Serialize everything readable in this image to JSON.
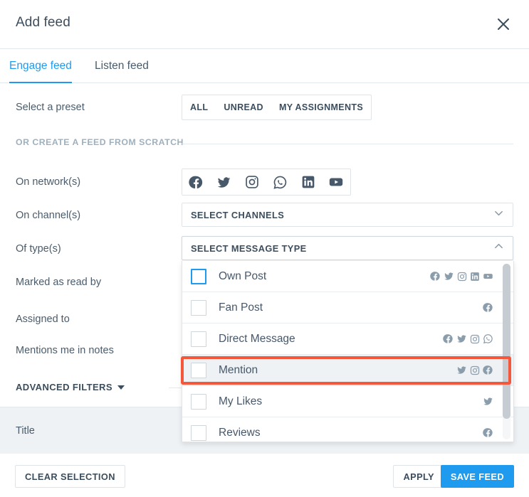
{
  "header": {
    "title": "Add feed",
    "close_icon": "close-icon"
  },
  "tabs": [
    {
      "label": "Engage feed",
      "active": true
    },
    {
      "label": "Listen feed",
      "active": false
    }
  ],
  "form": {
    "preset_label": "Select a preset",
    "presets": [
      "ALL",
      "UNREAD",
      "MY ASSIGNMENTS"
    ],
    "scratch_label": "OR CREATE A FEED FROM SCRATCH",
    "network_label": "On network(s)",
    "networks": [
      "facebook-icon",
      "twitter-icon",
      "instagram-icon",
      "whatsapp-icon",
      "linkedin-icon",
      "youtube-icon"
    ],
    "channel_label": "On channel(s)",
    "channel_select_value": "SELECT CHANNELS",
    "type_label": "Of type(s)",
    "type_select_value": "SELECT MESSAGE TYPE",
    "marked_read_label": "Marked as read by",
    "assigned_to_label": "Assigned to",
    "mentions_me_label": "Mentions me in notes",
    "advanced_filters_label": "ADVANCED FILTERS",
    "title_label": "Title"
  },
  "message_type_dropdown": {
    "expanded": true,
    "options": [
      {
        "label": "Own Post",
        "checked": false,
        "focused": true,
        "hover": false,
        "networks": [
          "facebook-icon",
          "twitter-icon",
          "instagram-icon",
          "linkedin-icon",
          "youtube-icon"
        ]
      },
      {
        "label": "Fan Post",
        "checked": false,
        "focused": false,
        "hover": false,
        "networks": [
          "facebook-icon"
        ]
      },
      {
        "label": "Direct Message",
        "checked": false,
        "focused": false,
        "hover": false,
        "networks": [
          "facebook-icon",
          "twitter-icon",
          "instagram-icon",
          "whatsapp-icon"
        ]
      },
      {
        "label": "Mention",
        "checked": false,
        "focused": false,
        "hover": true,
        "networks": [
          "twitter-icon",
          "instagram-icon",
          "facebook-icon"
        ]
      },
      {
        "label": "My Likes",
        "checked": false,
        "focused": false,
        "hover": false,
        "networks": [
          "twitter-icon"
        ]
      },
      {
        "label": "Reviews",
        "checked": false,
        "focused": false,
        "hover": false,
        "networks": [
          "facebook-icon"
        ]
      }
    ]
  },
  "annotation": {
    "target": "Mention",
    "color": "#f4573a"
  },
  "footer": {
    "clear_selection_label": "CLEAR SELECTION",
    "apply_label": "APPLY",
    "save_feed_label": "SAVE FEED"
  },
  "colors": {
    "accent": "#1e9bef",
    "text": "#3c4d5d",
    "muted": "#9fb0bd",
    "border": "#dfe4e8",
    "panel_gray": "#eef2f5",
    "annotation": "#f4573a",
    "icon_gray": "#8b9cab",
    "network_dark": "#47586a"
  }
}
